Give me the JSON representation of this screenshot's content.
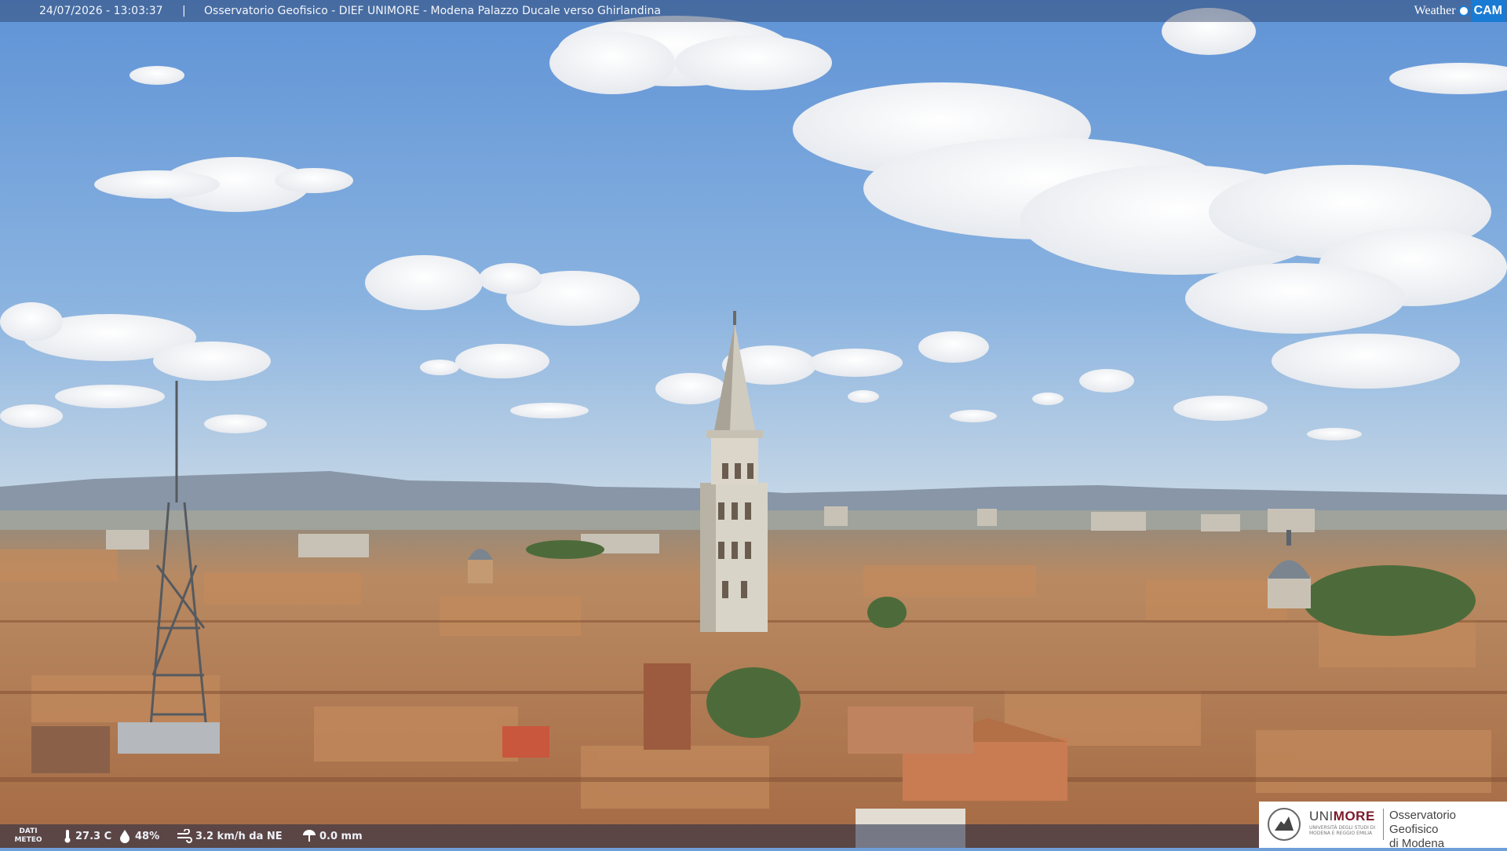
{
  "header": {
    "datetime": "24/07/2026 - 13:03:37",
    "separator": "|",
    "caption": "Osservatorio Geofisico - DIEF UNIMORE - Modena Palazzo Ducale verso Ghirlandina"
  },
  "brand": {
    "weather": "Weather",
    "cam": "CAM"
  },
  "weather": {
    "label_line1": "DATI",
    "label_line2": "METEO",
    "temperature": "27.3 C",
    "humidity": "48%",
    "wind": "3.2 km/h da NE",
    "rain": "0.0 mm"
  },
  "logo": {
    "uni_prefix": "UNI",
    "uni_suffix": "MORE",
    "uni_small": "UNIVERSITÀ DEGLI STUDI DI MODENA E REGGIO EMILIA",
    "line1": "Osservatorio Geofisico",
    "line2": "di Modena"
  },
  "colors": {
    "sky": "#6f9fd8",
    "roofs": "#b9825a",
    "brand_blue": "#1a7bd4",
    "unimore_red": "#7a1a2a"
  }
}
